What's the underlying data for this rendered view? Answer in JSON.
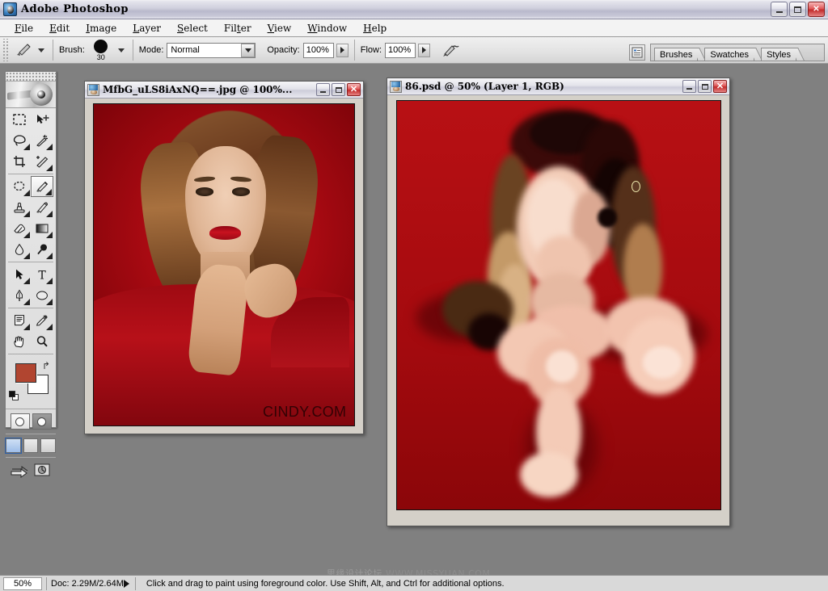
{
  "app": {
    "title": "Adobe Photoshop",
    "icon": "photoshop-app-icon",
    "window_buttons": {
      "minimize": "_",
      "maximize": "□",
      "close": "✕"
    }
  },
  "menubar": {
    "items": [
      {
        "label": "File",
        "accel": "F"
      },
      {
        "label": "Edit",
        "accel": "E"
      },
      {
        "label": "Image",
        "accel": "I"
      },
      {
        "label": "Layer",
        "accel": "L"
      },
      {
        "label": "Select",
        "accel": "S"
      },
      {
        "label": "Filter",
        "accel": "t"
      },
      {
        "label": "View",
        "accel": "V"
      },
      {
        "label": "Window",
        "accel": "W"
      },
      {
        "label": "Help",
        "accel": "H"
      }
    ]
  },
  "options_bar": {
    "active_tool": "brush-tool",
    "brush_label": "Brush:",
    "brush_size": "30",
    "mode_label": "Mode:",
    "mode_value": "Normal",
    "opacity_label": "Opacity:",
    "opacity_value": "100%",
    "flow_label": "Flow:",
    "flow_value": "100%",
    "airbrush_icon": "airbrush-icon"
  },
  "palette_well": {
    "dock_icon": "palette-dock-icon",
    "tabs": [
      {
        "label": "Brushes"
      },
      {
        "label": "Swatches"
      },
      {
        "label": "Styles"
      }
    ]
  },
  "toolbox": {
    "banner_icon": "photoshop-toolbox-banner",
    "tools": [
      {
        "name": "marquee-tool",
        "glyph": "marquee",
        "active": false,
        "has_flyout": false
      },
      {
        "name": "move-tool",
        "glyph": "move",
        "active": false,
        "has_flyout": false
      },
      {
        "name": "lasso-tool",
        "glyph": "lasso",
        "active": false,
        "has_flyout": true
      },
      {
        "name": "magic-wand-tool",
        "glyph": "wand",
        "active": false,
        "has_flyout": true
      },
      {
        "name": "crop-tool",
        "glyph": "crop",
        "active": false,
        "has_flyout": false
      },
      {
        "name": "slice-tool",
        "glyph": "slice",
        "active": false,
        "has_flyout": true
      },
      {
        "name": "healing-brush-tool",
        "glyph": "healing",
        "active": false,
        "has_flyout": true
      },
      {
        "name": "brush-tool",
        "glyph": "brush",
        "active": true,
        "has_flyout": true
      },
      {
        "name": "clone-stamp-tool",
        "glyph": "stamp",
        "active": false,
        "has_flyout": true
      },
      {
        "name": "history-brush-tool",
        "glyph": "historybrush",
        "active": false,
        "has_flyout": true
      },
      {
        "name": "eraser-tool",
        "glyph": "eraser",
        "active": false,
        "has_flyout": true
      },
      {
        "name": "gradient-tool",
        "glyph": "gradient",
        "active": false,
        "has_flyout": true
      },
      {
        "name": "blur-tool",
        "glyph": "blur",
        "active": false,
        "has_flyout": true
      },
      {
        "name": "dodge-tool",
        "glyph": "dodge",
        "active": false,
        "has_flyout": true
      },
      {
        "name": "path-selection-tool",
        "glyph": "pathselect",
        "active": false,
        "has_flyout": true
      },
      {
        "name": "type-tool",
        "glyph": "type",
        "active": false,
        "has_flyout": true
      },
      {
        "name": "pen-tool",
        "glyph": "pen",
        "active": false,
        "has_flyout": true
      },
      {
        "name": "shape-tool",
        "glyph": "ellipseshape",
        "active": false,
        "has_flyout": true
      },
      {
        "name": "notes-tool",
        "glyph": "notes",
        "active": false,
        "has_flyout": true
      },
      {
        "name": "eyedropper-tool",
        "glyph": "eyedropper",
        "active": false,
        "has_flyout": true
      },
      {
        "name": "hand-tool",
        "glyph": "hand",
        "active": false,
        "has_flyout": false
      },
      {
        "name": "zoom-tool",
        "glyph": "zoom",
        "active": false,
        "has_flyout": false
      }
    ],
    "colors": {
      "foreground": "#b14530",
      "background": "#ffffff",
      "swap_icon": "swap-colors-icon",
      "default_icon": "default-colors-icon"
    },
    "mask_modes": [
      {
        "name": "standard-mode-button",
        "selected": true
      },
      {
        "name": "quick-mask-mode-button",
        "selected": false
      }
    ],
    "screen_modes": [
      {
        "name": "standard-screen-mode-button",
        "selected": true
      },
      {
        "name": "full-screen-with-menubar-button",
        "selected": false
      },
      {
        "name": "full-screen-mode-button",
        "selected": false
      }
    ],
    "jump_buttons": [
      {
        "name": "jump-to-imageready-button"
      },
      {
        "name": "jump-to-other-app-button"
      }
    ]
  },
  "documents": [
    {
      "id": "doc-photo",
      "title": "MfbG_uLS8iAxNQ==.jpg @ 100%...",
      "zoom": "100%",
      "watermark": "CINDY.COM",
      "icon": "jpeg-document-icon"
    },
    {
      "id": "doc-paint",
      "title": "86.psd @ 50%  (Layer 1, RGB)",
      "zoom": "50%",
      "icon": "psd-document-icon",
      "brush_cursor": "brush-circle-cursor"
    }
  ],
  "status_bar": {
    "zoom_value": "50%",
    "doc_info": "Doc: 2.29M/2.64M",
    "menu_arrow_icon": "status-menu-arrow-icon",
    "hint": "Click and drag to paint using foreground color. Use Shift, Alt, and Ctrl for additional options."
  },
  "watermark_overlay": {
    "chinese": "思缘设计论坛",
    "url": "WWW.MISSYUAN.COM"
  },
  "colors": {
    "desktop": "#808080",
    "canvas_red": "#ad0c10",
    "foreground": "#b14530",
    "chrome": "#d4d0c8"
  }
}
